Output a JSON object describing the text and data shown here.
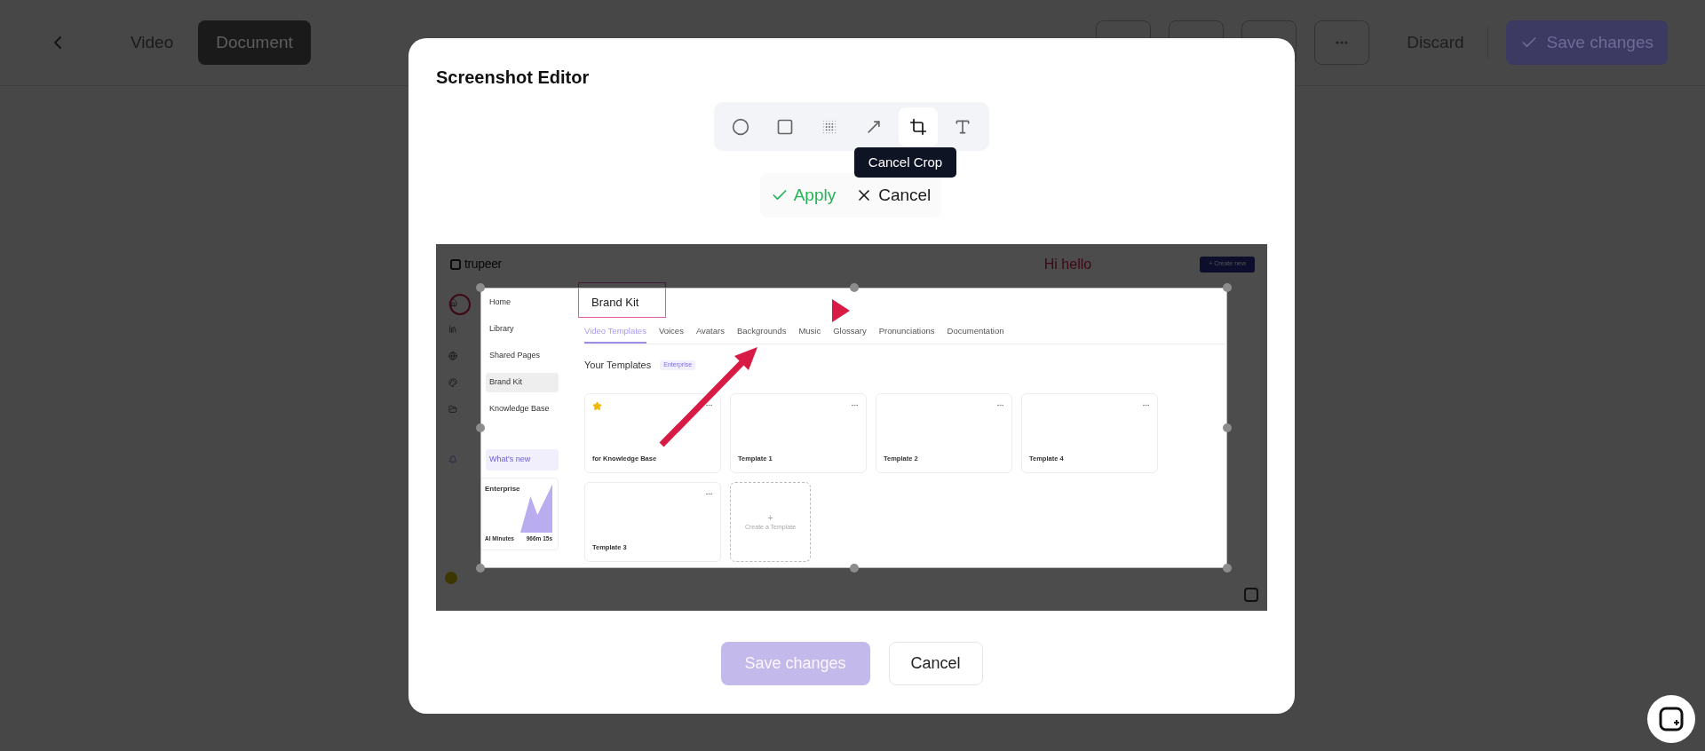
{
  "topbar": {
    "tabs": [
      {
        "label": "Video",
        "selected": false
      },
      {
        "label": "Document",
        "selected": true
      }
    ],
    "discard": "Discard",
    "save": "Save changes"
  },
  "modal": {
    "title": "Screenshot Editor",
    "tools": [
      {
        "kind": "circle",
        "selected": false
      },
      {
        "kind": "rectangle",
        "selected": false
      },
      {
        "kind": "blur",
        "selected": false
      },
      {
        "kind": "arrow",
        "selected": false
      },
      {
        "kind": "crop",
        "selected": true
      },
      {
        "kind": "text",
        "selected": false
      }
    ],
    "tooltip": "Cancel Crop",
    "apply": "Apply",
    "cancel": "Cancel",
    "footer": {
      "save": {
        "label": "Save changes",
        "disabled": true
      },
      "cancel": "Cancel"
    }
  },
  "screenshot": {
    "logo": "trupeer",
    "note": "Hi hello",
    "create_button": "+ Create new",
    "sidebar": [
      {
        "label": "Home",
        "selected": false
      },
      {
        "label": "Library",
        "selected": false
      },
      {
        "label": "Shared Pages",
        "selected": false
      },
      {
        "label": "Brand Kit",
        "selected": true
      },
      {
        "label": "Knowledge Base",
        "selected": false
      }
    ],
    "whats_new": "What's new",
    "plan": {
      "name": "Enterprise",
      "minutes_label": "AI Minutes",
      "minutes": "966m 15s"
    },
    "title": "Brand Kit",
    "tabs": [
      {
        "label": "Video Templates",
        "selected": true
      },
      {
        "label": "Voices",
        "selected": false
      },
      {
        "label": "Avatars",
        "selected": false
      },
      {
        "label": "Backgrounds",
        "selected": false
      },
      {
        "label": "Music",
        "selected": false
      },
      {
        "label": "Glossary",
        "selected": false
      },
      {
        "label": "Pronunciations",
        "selected": false
      },
      {
        "label": "Documentation",
        "selected": false
      }
    ],
    "section": "Your Templates",
    "badge": "Enterprise",
    "templates": [
      {
        "name": "for Knowledge Base",
        "starred": true
      },
      {
        "name": "Template 1",
        "starred": false
      },
      {
        "name": "Template 2",
        "starred": false
      },
      {
        "name": "Template 4",
        "starred": false
      },
      {
        "name": "Template 3",
        "starred": false
      }
    ],
    "create_plus": "+",
    "create_label": "Create a Template"
  }
}
